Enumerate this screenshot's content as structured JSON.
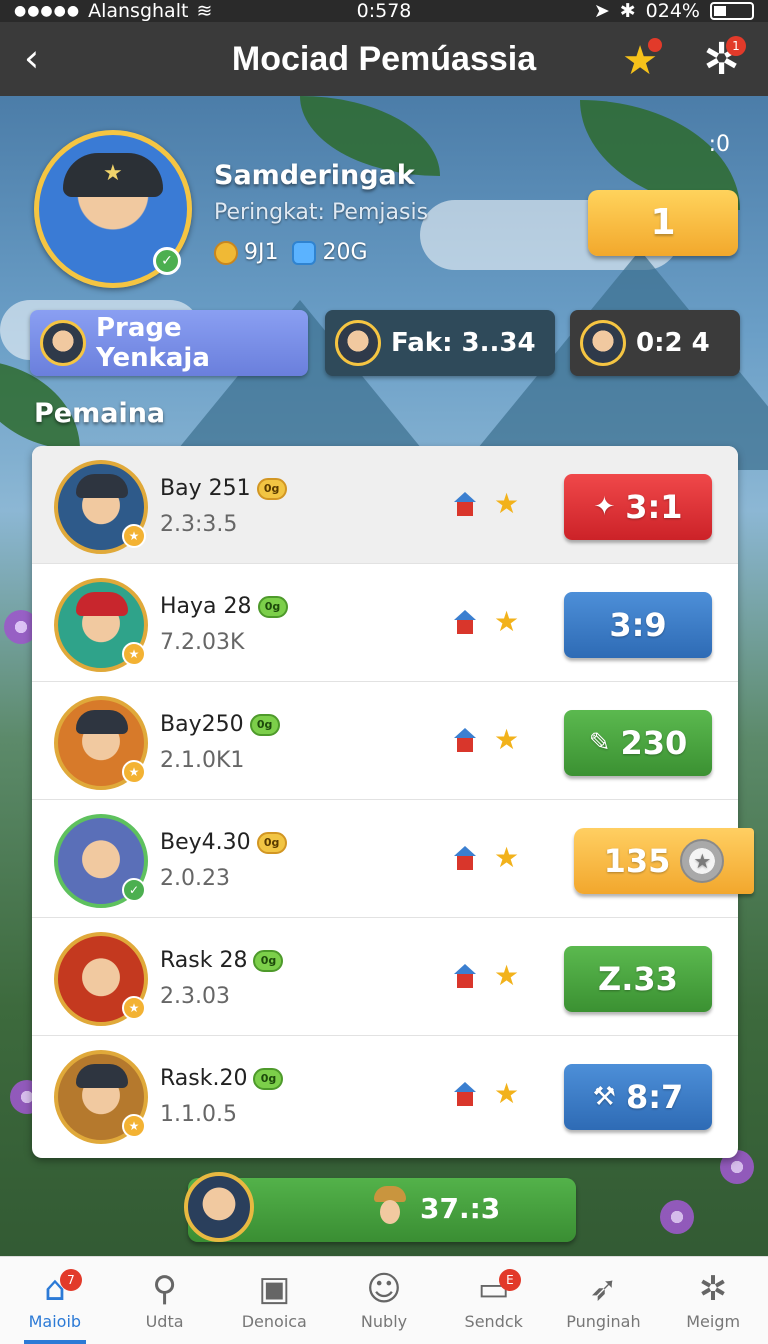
{
  "status_bar": {
    "carrier": "Alansghalt",
    "time": "0:578",
    "battery": "024%"
  },
  "header": {
    "title": "Mociad Pemúassia",
    "star_badge": "",
    "gear_badge": "1"
  },
  "profile": {
    "name": "Samderingak",
    "rank_line": "Peringkat: Pemjasis",
    "coins": "9J1",
    "gems": "20G",
    "corner_counter": ":0",
    "rank_value": "1"
  },
  "filters": [
    {
      "label": "Prage Yenkaja"
    },
    {
      "label": "Fak: 3..34"
    },
    {
      "label": "0:2 4"
    }
  ],
  "section_label": "Pemaina",
  "rows": [
    {
      "name": "Bay 251",
      "tag": "0g",
      "sub": "2.3:3.5",
      "score": "3:1",
      "score_style": "red",
      "score_icon": "star-hammer"
    },
    {
      "name": "Haya 28",
      "tag": "0g",
      "sub": "7.2.03K",
      "score": "3:9",
      "score_style": "blue",
      "score_icon": ""
    },
    {
      "name": "Bay250",
      "tag": "0g",
      "sub": "2.1.0K1",
      "score": "230",
      "score_style": "green",
      "score_icon": "pen"
    },
    {
      "name": "Bey4.30",
      "tag": "0g",
      "sub": "2.0.23",
      "score": "135",
      "score_style": "gold",
      "score_icon": "medal"
    },
    {
      "name": "Rask 28",
      "tag": "0g",
      "sub": "2.3.03",
      "score": "Z.33",
      "score_style": "green",
      "score_icon": ""
    },
    {
      "name": "Rask.20",
      "tag": "0g",
      "sub": "1.1.0.5",
      "score": "8:7",
      "score_style": "blue",
      "score_icon": "hammer"
    }
  ],
  "bottom_strip": {
    "value": "37.:3"
  },
  "nav": [
    {
      "label": "Maioib",
      "icon": "home-icon",
      "badge": "7",
      "active": true
    },
    {
      "label": "Udta",
      "icon": "search-user-icon",
      "badge": "",
      "active": false
    },
    {
      "label": "Denoica",
      "icon": "camera-icon",
      "badge": "",
      "active": false
    },
    {
      "label": "Nubly",
      "icon": "face-icon",
      "badge": "",
      "active": false
    },
    {
      "label": "Sendck",
      "icon": "chat-icon",
      "badge": "E",
      "active": false
    },
    {
      "label": "Punginah",
      "icon": "rocket-icon",
      "badge": "",
      "active": false
    },
    {
      "label": "Meigm",
      "icon": "gear-icon",
      "badge": "",
      "active": false
    }
  ],
  "colors": {
    "accent_blue": "#2c7ad6",
    "score_red": "#e0363a",
    "score_blue": "#3e7ec7",
    "score_green": "#4aa640",
    "score_gold": "#f7bb46"
  }
}
